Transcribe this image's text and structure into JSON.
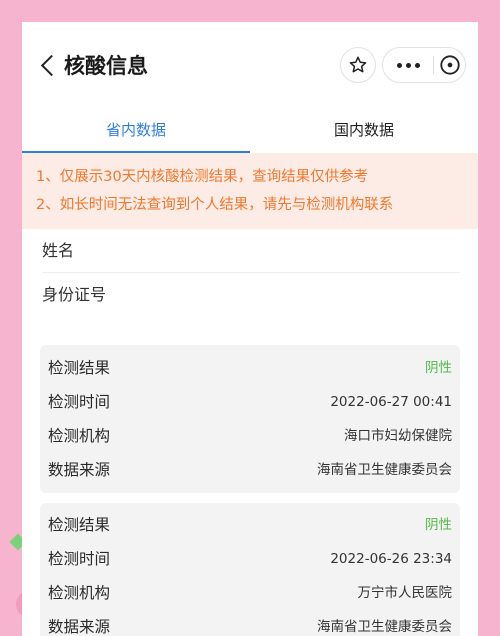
{
  "header": {
    "title": "核酸信息",
    "icons": {
      "back": "chevron-left-icon",
      "star": "star-icon",
      "more": "more-dots-icon",
      "close": "close-circle-icon"
    }
  },
  "tabs": [
    {
      "label": "省内数据",
      "active": true
    },
    {
      "label": "国内数据",
      "active": false
    }
  ],
  "notice": {
    "line1": "1、仅展示30天内核酸检测结果，查询结果仅供参考",
    "line2": "2、如长时间无法查询到个人结果，请先与检测机构联系"
  },
  "user": {
    "name_label": "姓名",
    "id_label": "身份证号"
  },
  "results": [
    {
      "result_label": "检测结果",
      "result_value": "阴性",
      "time_label": "检测时间",
      "time_value": "2022-06-27 00:41",
      "org_label": "检测机构",
      "org_value": "海口市妇幼保健院",
      "source_label": "数据来源",
      "source_value": "海南省卫生健康委员会"
    },
    {
      "result_label": "检测结果",
      "result_value": "阴性",
      "time_label": "检测时间",
      "time_value": "2022-06-26 23:34",
      "org_label": "检测机构",
      "org_value": "万宁市人民医院",
      "source_label": "数据来源",
      "source_value": "海南省卫生健康委员会"
    }
  ],
  "colors": {
    "accent": "#2f7fe0",
    "notice_text": "#f0782e",
    "notice_bg": "#fdebe5",
    "negative": "#55b84d",
    "background": "#f7b4cf"
  }
}
